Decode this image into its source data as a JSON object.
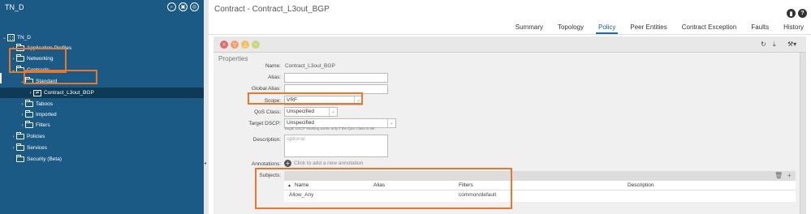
{
  "sidebar": {
    "header": "TN_D",
    "items": [
      {
        "label": "TN_D"
      },
      {
        "label": "Application Profiles"
      },
      {
        "label": "Networking"
      },
      {
        "label": "Contracts"
      },
      {
        "label": "Standard"
      },
      {
        "label": "Contract_L3out_BGP"
      },
      {
        "label": "Taboos"
      },
      {
        "label": "Imported"
      },
      {
        "label": "Filters"
      },
      {
        "label": "Policies"
      },
      {
        "label": "Services"
      },
      {
        "label": "Security (Beta)"
      }
    ]
  },
  "main": {
    "title": "Contract - Contract_L3out_BGP",
    "tabs": [
      {
        "label": "Summary"
      },
      {
        "label": "Topology"
      },
      {
        "label": "Policy"
      },
      {
        "label": "Peer Entities"
      },
      {
        "label": "Contract Exception"
      },
      {
        "label": "Faults"
      },
      {
        "label": "History"
      }
    ],
    "active_tab": "Policy",
    "properties_label": "Properties",
    "form": {
      "name_label": "Name:",
      "name_value": "Contract_L3out_BGP",
      "alias_label": "Alias:",
      "global_alias_label": "Global Alias:",
      "scope_label": "Scope:",
      "scope_value": "VRF",
      "qos_label": "QoS Class:",
      "qos_value": "Unspecified",
      "dscp_label": "Target DSCP:",
      "dscp_value": "Unspecified",
      "dscp_hint": "Target DSCP Marking works only if the QoS Class is set",
      "description_label": "Description:",
      "description_placeholder": "optional",
      "annotations_label": "Annotations:",
      "annotations_add": "Click to add a new annotation",
      "subjects_label": "Subjects:"
    },
    "subjects": {
      "columns": [
        "Name",
        "Alias",
        "Filters",
        "Description"
      ],
      "rows": [
        {
          "name": "Allow_Any",
          "alias": "",
          "filters": "common/default",
          "description": ""
        }
      ]
    }
  },
  "colors": {
    "sidebar_bg": "#1b5a85",
    "highlight": "#e8782a",
    "active_tab": "#1b6fa8"
  }
}
